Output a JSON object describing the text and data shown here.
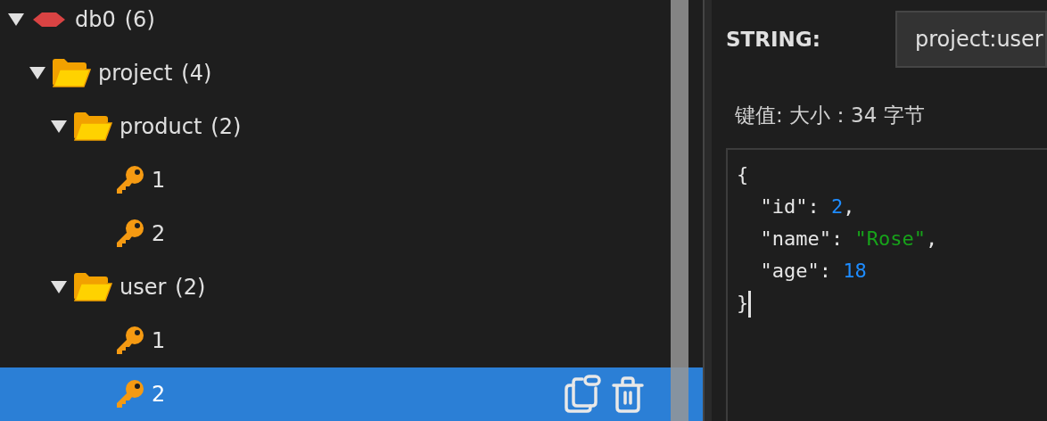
{
  "tree": [
    {
      "kind": "db",
      "label": "db0",
      "count": "(6)",
      "expanded": true,
      "selected": false,
      "children": [
        {
          "kind": "folder",
          "label": "project",
          "count": "(4)",
          "expanded": true,
          "selected": false,
          "children": [
            {
              "kind": "folder",
              "label": "product",
              "count": "(2)",
              "expanded": true,
              "selected": false,
              "children": [
                {
                  "kind": "key",
                  "label": "1",
                  "selected": false
                },
                {
                  "kind": "key",
                  "label": "2",
                  "selected": false
                }
              ]
            },
            {
              "kind": "folder",
              "label": "user",
              "count": "(2)",
              "expanded": true,
              "selected": false,
              "children": [
                {
                  "kind": "key",
                  "label": "1",
                  "selected": false
                },
                {
                  "kind": "key",
                  "label": "2",
                  "selected": true
                }
              ]
            }
          ]
        }
      ]
    }
  ],
  "detail": {
    "type_label": "STRING:",
    "key_name": "project:user",
    "size_label": "键值: 大小：34 字节",
    "code": [
      [
        {
          "kind": "punct",
          "text": "{"
        }
      ],
      [
        {
          "kind": "punct",
          "text": "  \"id\": "
        },
        {
          "kind": "number",
          "text": "2"
        },
        {
          "kind": "punct",
          "text": ","
        }
      ],
      [
        {
          "kind": "punct",
          "text": "  \"name\": "
        },
        {
          "kind": "string",
          "text": "\"Rose\""
        },
        {
          "kind": "punct",
          "text": ","
        }
      ],
      [
        {
          "kind": "punct",
          "text": "  \"age\": "
        },
        {
          "kind": "number",
          "text": "18"
        }
      ],
      [
        {
          "kind": "punct",
          "text": "}"
        }
      ]
    ]
  }
}
